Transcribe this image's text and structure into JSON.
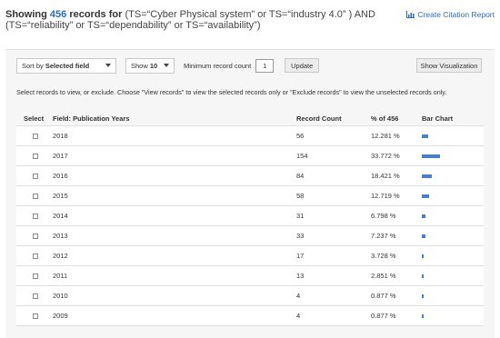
{
  "header": {
    "prefix": "Showing",
    "count": "456",
    "records_for": "records for",
    "query": "(TS=“Cyber Physical system” or TS=“industry 4.0” ) AND (TS=“reliability” or TS=“dependability” or TS=“availability”)"
  },
  "citation_report": {
    "label": "Create Citation Report",
    "icon": "bar-chart-icon"
  },
  "controls": {
    "sort_prefix": "Sort by",
    "sort_value": "Selected field",
    "show_prefix": "Show",
    "show_value": "10",
    "min_label": "Minimum record count",
    "min_value": "1",
    "update_label": "Update",
    "visualization_label": "Show Visualization"
  },
  "instructions": "Select records to view, or exclude. Choose \"View records\" to view the selected records only or \"Exclude records\" to view the unselected records only.",
  "table": {
    "headers": {
      "select": "Select",
      "field": "Field: Publication Years",
      "count": "Record Count",
      "pct": "% of 456",
      "bar": "Bar Chart"
    },
    "rows": [
      {
        "year": "2018",
        "count": "56",
        "pct": "12.281 %",
        "share": 12.281
      },
      {
        "year": "2017",
        "count": "154",
        "pct": "33.772 %",
        "share": 33.772
      },
      {
        "year": "2016",
        "count": "84",
        "pct": "18.421 %",
        "share": 18.421
      },
      {
        "year": "2015",
        "count": "58",
        "pct": "12.719 %",
        "share": 12.719
      },
      {
        "year": "2014",
        "count": "31",
        "pct": "6.798 %",
        "share": 6.798
      },
      {
        "year": "2013",
        "count": "33",
        "pct": "7.237 %",
        "share": 7.237
      },
      {
        "year": "2012",
        "count": "17",
        "pct": "3.728 %",
        "share": 3.728
      },
      {
        "year": "2011",
        "count": "13",
        "pct": "2.851 %",
        "share": 2.851
      },
      {
        "year": "2010",
        "count": "4",
        "pct": "0.877 %",
        "share": 0.877
      },
      {
        "year": "2009",
        "count": "4",
        "pct": "0.877 %",
        "share": 0.877
      }
    ]
  },
  "colors": {
    "accent": "#2a6db5",
    "bar": "#4a7ec8"
  }
}
